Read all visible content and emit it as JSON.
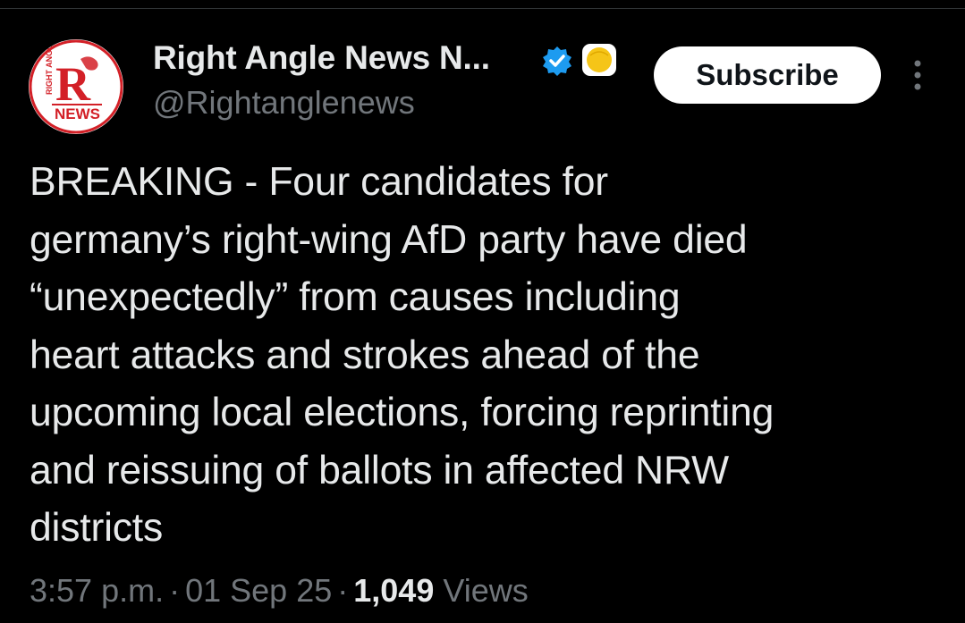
{
  "account": {
    "display_name": "Right Angle News N...",
    "handle": "@Rightanglenews",
    "logo_text_top": "RIGHT ANGLE",
    "logo_letter": "R",
    "logo_text_bottom": "NEWS"
  },
  "actions": {
    "subscribe_label": "Subscribe"
  },
  "tweet": {
    "text": "BREAKING - Four candidates for\ngermany’s right-wing AfD party have died\n“unexpectedly” from causes including\nheart attacks and strokes ahead of the\nupcoming local elections, forcing reprinting\nand reissuing of ballots in affected NRW\ndistricts",
    "time": "3:57 p.m.",
    "separator": "·",
    "date": "01 Sep 25",
    "views_count": "1,049",
    "views_label": "Views"
  },
  "icons": {
    "verified": "verified-badge-icon",
    "affiliate": "affiliate-badge-icon",
    "more": "more-vertical-icon"
  },
  "colors": {
    "background": "#000000",
    "text_primary": "#e7e9ea",
    "text_secondary": "#71767b",
    "verified_blue": "#1d9bf0",
    "affiliate_gold": "#f5c518",
    "logo_red": "#d32027"
  }
}
